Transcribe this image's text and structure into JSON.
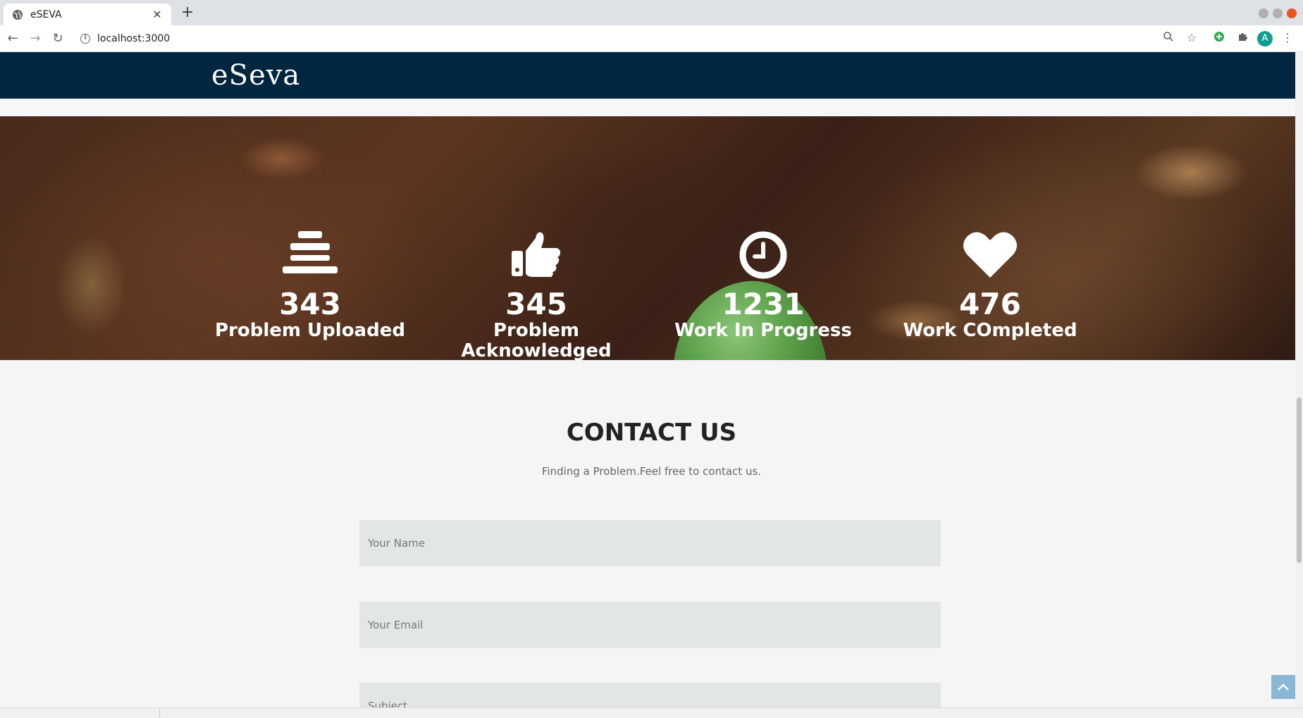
{
  "browser": {
    "tab_title": "eSEVA",
    "url": "localhost:3000",
    "profile_initial": "A",
    "icons": [
      "globe-icon",
      "close-icon",
      "plus-icon",
      "back-icon",
      "forward-icon",
      "reload-icon",
      "info-icon",
      "zoom-icon",
      "star-icon",
      "extension-icon",
      "puzzle-icon",
      "menu-icon"
    ]
  },
  "site": {
    "logo": "eSeva"
  },
  "stats": [
    {
      "icon": "bars-icon",
      "number": "343",
      "label": "Problem Uploaded"
    },
    {
      "icon": "thumbs-up-icon",
      "number": "345",
      "label": "Problem Acknowledged"
    },
    {
      "icon": "clock-icon",
      "number": "1231",
      "label": "Work In Progress"
    },
    {
      "icon": "heart-icon",
      "number": "476",
      "label": "Work COmpleted"
    }
  ],
  "contact": {
    "title": "CONTACT US",
    "subtitle": "Finding a Problem.Feel free to contact us.",
    "name_placeholder": "Your Name",
    "email_placeholder": "Your Email",
    "subject_placeholder": "Subject"
  },
  "colors": {
    "navbar": "#002640",
    "field_bg": "#e2e7e3",
    "back_to_top": "#8ab7d6"
  }
}
